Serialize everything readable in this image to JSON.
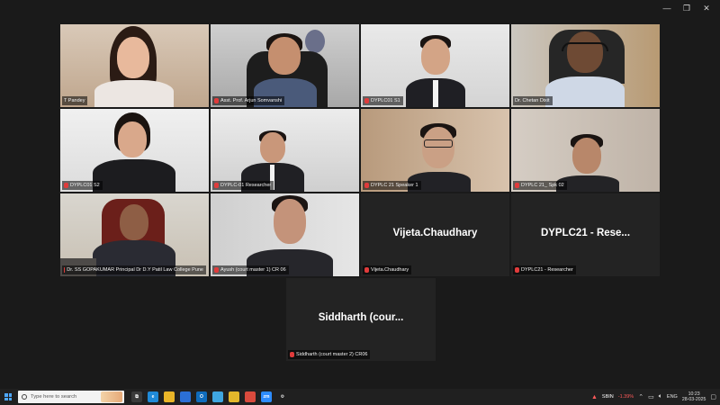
{
  "window": {
    "controls": [
      "—",
      "❐",
      "✕"
    ]
  },
  "tiles": [
    {
      "id": "t1",
      "name": "T Pandey",
      "active": false
    },
    {
      "id": "t2",
      "name": "Asst. Prof. Arjun Somvanshi",
      "active": false
    },
    {
      "id": "t3",
      "name": "DYPLC01 S1",
      "active": false
    },
    {
      "id": "t4",
      "name": "Dr. Chetan Dixit",
      "active": true
    },
    {
      "id": "t5",
      "name": "DYPLC01 S2",
      "active": false
    },
    {
      "id": "t6",
      "name": "DYPLC-01 Researcher",
      "active": false
    },
    {
      "id": "t7",
      "name": "DYPLC 21 Speaker 1",
      "active": false
    },
    {
      "id": "t8",
      "name": "DYPLC 21_ Spk 02",
      "active": false
    },
    {
      "id": "t9",
      "name": "Dr. SS GOPAKUMAR Principal Dr D.Y Patil Law College Pune",
      "active": false
    },
    {
      "id": "t10",
      "name": "Ayush (court master 1) CR 06",
      "active": false
    },
    {
      "id": "t11",
      "name": "Vijeta.Chaudhary",
      "display": "Vijeta.Chaudhary",
      "active": false
    },
    {
      "id": "t12",
      "name": "DYPLC21 - Researcher",
      "display": "DYPLC21  - Rese...",
      "active": false
    },
    {
      "id": "t13",
      "name": "Siddharth (court master 2) CR06",
      "display": "Siddharth  (cour...",
      "active": false
    }
  ],
  "taskbar": {
    "search_placeholder": "Type here to search",
    "stock_name": "SBIN",
    "stock_change": "-1.39%",
    "language": "ENG",
    "time": "10:23",
    "date": "28-03-2025",
    "apps": [
      {
        "name": "task-view",
        "color": "#3a3a3a",
        "label": "⧉"
      },
      {
        "name": "edge",
        "color": "#1f8ad8",
        "label": "e"
      },
      {
        "name": "file-explorer",
        "color": "#e9b528",
        "label": ""
      },
      {
        "name": "store",
        "color": "#2b6fd6",
        "label": ""
      },
      {
        "name": "outlook",
        "color": "#0f6cbd",
        "label": "O"
      },
      {
        "name": "teams-alt",
        "color": "#3fa6e0",
        "label": ""
      },
      {
        "name": "chrome",
        "color": "#e3b72b",
        "label": ""
      },
      {
        "name": "chrome-2",
        "color": "#d94a3d",
        "label": ""
      },
      {
        "name": "zoom",
        "color": "#2d8cff",
        "label": "zm"
      },
      {
        "name": "settings",
        "color": "#202020",
        "label": "⚙"
      }
    ]
  }
}
